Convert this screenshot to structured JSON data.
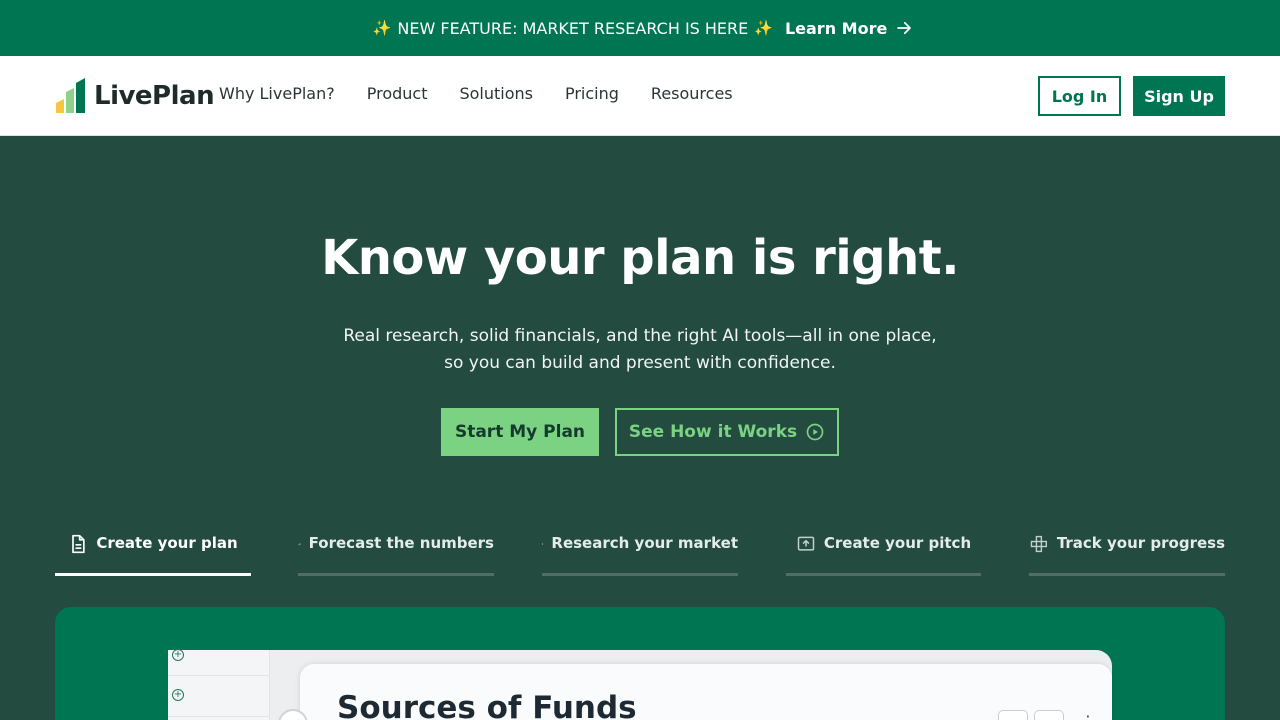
{
  "banner": {
    "sparkle_left": "✨",
    "text": "NEW FEATURE: MARKET RESEARCH IS HERE",
    "sparkle_right": "✨",
    "link_label": "Learn More"
  },
  "nav": {
    "logo_text": "LivePlan",
    "links": [
      "Why LivePlan?",
      "Product",
      "Solutions",
      "Pricing",
      "Resources"
    ],
    "login_label": "Log In",
    "signup_label": "Sign Up"
  },
  "hero": {
    "title": "Know your plan is right.",
    "subtitle_line1": "Real research, solid financials, and the right AI tools—all in one place,",
    "subtitle_line2": "so you can build and present with confidence.",
    "primary_cta": "Start My Plan",
    "secondary_cta": "See How it Works"
  },
  "tabs": [
    {
      "label": "Create your plan",
      "icon": "document-icon",
      "active": true
    },
    {
      "label": "Forecast the numbers",
      "icon": "bar-chart-icon",
      "active": false
    },
    {
      "label": "Research your market",
      "icon": "building-icon",
      "active": false
    },
    {
      "label": "Create your pitch",
      "icon": "presentation-icon",
      "active": false
    },
    {
      "label": "Track your progress",
      "icon": "grid-squares-icon",
      "active": false
    }
  ],
  "preview": {
    "title": "Sources of Funds"
  },
  "colors": {
    "brand_green": "#007551",
    "hero_bg": "#234b40",
    "accent_light_green": "#7bd282",
    "logo_yellow": "#f6c542",
    "logo_light_green": "#8fd08a"
  }
}
